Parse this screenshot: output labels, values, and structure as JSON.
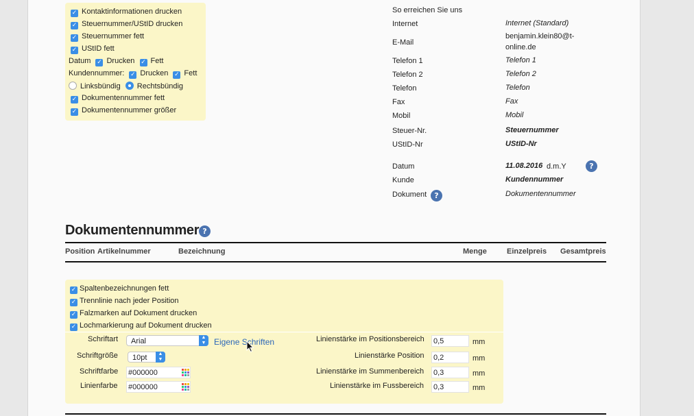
{
  "options_top": [
    {
      "label": "Kontaktinformationen drucken",
      "checked": true
    },
    {
      "label": "Steuernummer/UStID drucken",
      "checked": true
    },
    {
      "label": "Steuernummer fett",
      "checked": true
    },
    {
      "label": "UStID fett",
      "checked": true
    }
  ],
  "datum_row": {
    "label": "Datum",
    "drucken": "Drucken",
    "fett": "Fett"
  },
  "kundennummer_row": {
    "label": "Kundennummer:",
    "drucken": "Drucken",
    "fett": "Fett"
  },
  "alignment": {
    "left": "Linksbündig",
    "right": "Rechtsbündig",
    "selected": "right"
  },
  "options_bottom": [
    {
      "label": "Dokumentennummer fett",
      "checked": true
    },
    {
      "label": "Dokumentennummer größer",
      "checked": true
    }
  ],
  "contact": {
    "heading": "So erreichen Sie uns",
    "rows": [
      {
        "label": "Internet",
        "value": "Internet (Standard)"
      },
      {
        "label": "E-Mail",
        "value_line1": "benjamin.klein80@t-",
        "value_line2": "online.de"
      },
      {
        "label": "Telefon 1",
        "value": "Telefon 1"
      },
      {
        "label": "Telefon 2",
        "value": "Telefon 2"
      },
      {
        "label": "Telefon",
        "value": "Telefon"
      },
      {
        "label": "Fax",
        "value": "Fax"
      },
      {
        "label": "Mobil",
        "value": "Mobil"
      },
      {
        "label": "Steuer-Nr.",
        "value": "Steuernummer"
      },
      {
        "label": "UStID-Nr",
        "value": "UStID-Nr"
      }
    ],
    "datum": {
      "label": "Datum",
      "value": "11.08.2016",
      "format": "d.m.Y"
    },
    "kunde": {
      "label": "Kunde",
      "value": "Kundennummer"
    },
    "dokument": {
      "label": "Dokument",
      "value": "Dokumentennummer"
    }
  },
  "section_title": "Dokumentennummer",
  "help_glyph": "?",
  "columns": [
    "Position",
    "Artikelnummer",
    "Bezeichnung",
    "Menge",
    "Einzelpreis",
    "Gesamtpreis"
  ],
  "table_options": [
    {
      "label": "Spaltenbezeichnungen fett",
      "checked": true
    },
    {
      "label": "Trennlinie nach jeder Position",
      "checked": true
    },
    {
      "label": "Falzmarken auf Dokument drucken",
      "checked": true
    },
    {
      "label": "Lochmarkierung auf Dokument drucken",
      "checked": true
    }
  ],
  "font_settings": {
    "schriftart_label": "Schriftart",
    "schriftart_value": "Arial",
    "eigene_schriften": "Eigene Schriften",
    "schriftgroesse_label": "Schriftgröße",
    "schriftgroesse_value": "10pt",
    "schriftfarbe_label": "Schriftfarbe",
    "schriftfarbe_value": "#000000",
    "linienfarbe_label": "Linienfarbe",
    "linienfarbe_value": "#000000"
  },
  "line_settings": [
    {
      "label": "Linienstärke im Positionsbereich",
      "value": "0,5",
      "unit": "mm"
    },
    {
      "label": "Linienstärke Position",
      "value": "0,2",
      "unit": "mm"
    },
    {
      "label": "Linienstärke im Summenbereich",
      "value": "0,3",
      "unit": "mm"
    },
    {
      "label": "Linienstärke im Fussbereich",
      "value": "0,3",
      "unit": "mm"
    }
  ],
  "colors": {
    "accent": "#3a8ee6",
    "panel": "#fbf6c8",
    "help": "#4a73b0",
    "link": "#2a66b8"
  }
}
